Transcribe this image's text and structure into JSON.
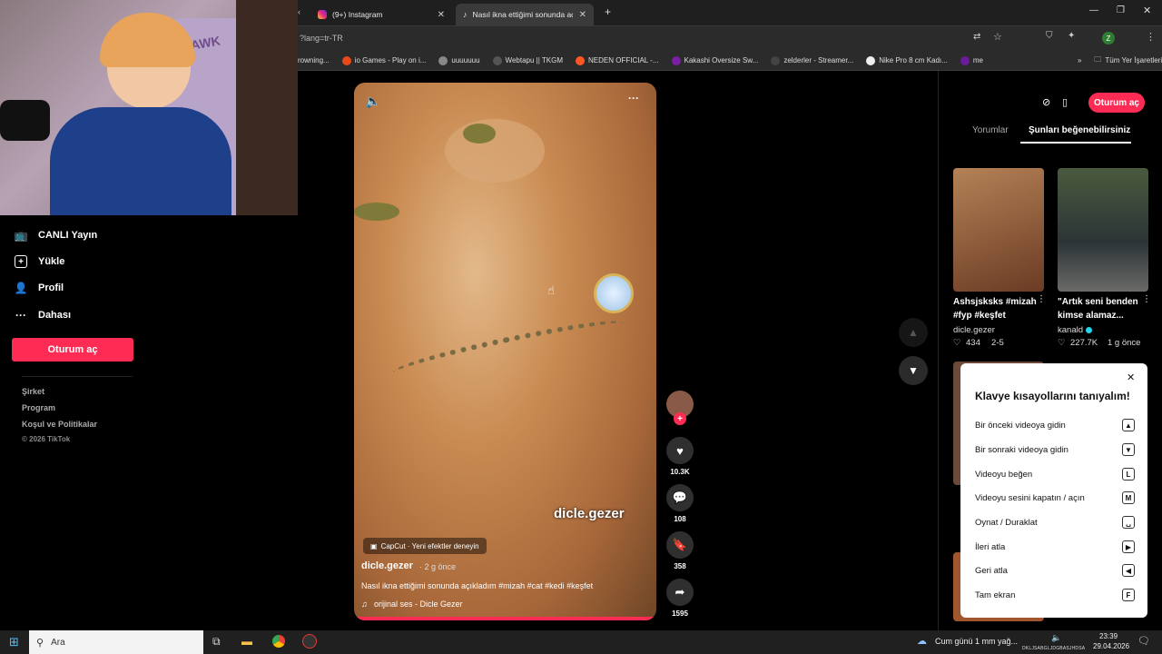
{
  "browser": {
    "tabs": [
      {
        "title": "(9+) Instagram"
      },
      {
        "title": "Nasıl ikna ettiğimi sonunda açı"
      }
    ],
    "new_tab": "+",
    "address": "?lang=tr-TR",
    "bookmarks": [
      "rowning...",
      "io Games - Play on i...",
      "uuuuuuu",
      "Webtapu || TKGM",
      "NEDEN OFFICIAL -...",
      "Kakashi Oversize Sw...",
      "zelderler - Streamer...",
      "Nike Pro 8 cm Kadı...",
      "me"
    ],
    "bookmarks_more": "»",
    "all_bookmarks": "Tüm Yer İşaretleri"
  },
  "webcam": {
    "chair_text": "HAWK"
  },
  "sidebar": {
    "items": [
      {
        "label": "CANLI Yayın"
      },
      {
        "label": "Yükle"
      },
      {
        "label": "Profil"
      },
      {
        "label": "Dahası"
      }
    ],
    "signin": "Oturum aç",
    "footer": [
      "Şirket",
      "Program",
      "Koşul ve Politikalar",
      "© 2026 TikTok"
    ]
  },
  "video": {
    "watermark": "dicle.gezer",
    "capcut": "CapCut · Yeni efektler deneyin",
    "author": "dicle.gezer",
    "time": "· 2 g önce",
    "caption": "Nasıl ikna ettiğimi sonunda açıkladım #mizah #cat #kedi #keşfet",
    "sound": "orijinal ses - Dicle Gezer",
    "more": "···"
  },
  "actions": {
    "likes": "10.3K",
    "comments": "108",
    "saves": "358",
    "shares": "1595"
  },
  "right": {
    "signin": "Oturum aç",
    "tabs": [
      "Yorumlar",
      "Şunları beğenebilirsiniz"
    ],
    "cards": [
      {
        "title": "Ashsjsksks #mizah #fyp #keşfet",
        "author": "dicle.gezer",
        "likes": "434",
        "date": "2-5"
      },
      {
        "title": "\"Artık seni benden kimse alamaz...",
        "author": "kanald",
        "likes": "227.7K",
        "date": "1 g önce"
      }
    ]
  },
  "shortcuts": {
    "title": "Klavye kısayollarını tanıyalım!",
    "rows": [
      {
        "label": "Bir önceki videoya gidin",
        "key": "▲"
      },
      {
        "label": "Bir sonraki videoya gidin",
        "key": "▼"
      },
      {
        "label": "Videoyu beğen",
        "key": "L"
      },
      {
        "label": "Videoyu sesini kapatın / açın",
        "key": "M"
      },
      {
        "label": "Oynat / Duraklat",
        "key": "␣"
      },
      {
        "label": "İleri atla",
        "key": "▶"
      },
      {
        "label": "Geri atla",
        "key": "◀"
      },
      {
        "label": "Tam ekran",
        "key": "F"
      }
    ]
  },
  "taskbar": {
    "search": "Ara",
    "weather": "Cum günü 1 mm yağ...",
    "ticker": "DKLJSABGLJDGBASJHDSA",
    "time": "23:39",
    "date": "29.04.2026"
  }
}
